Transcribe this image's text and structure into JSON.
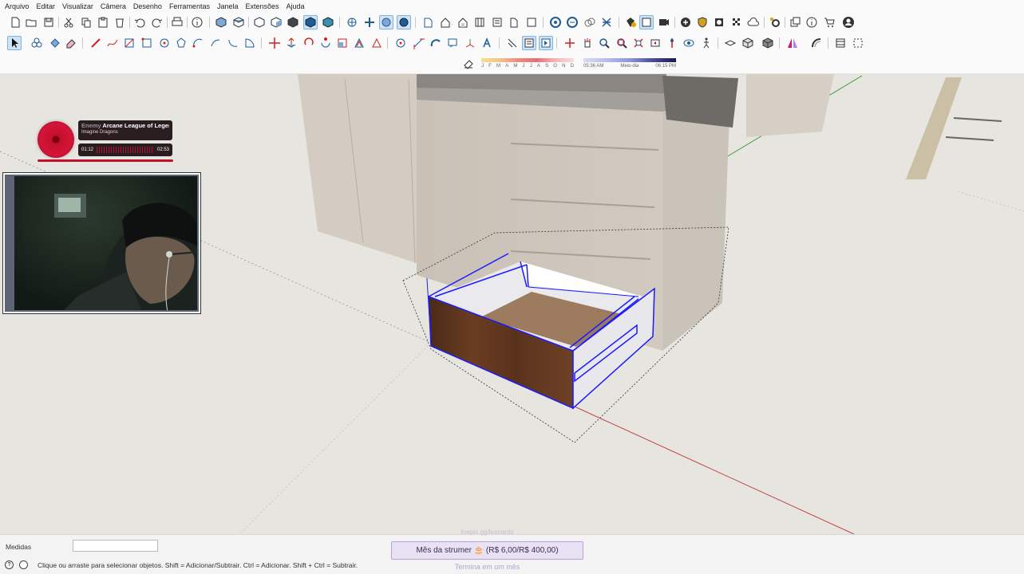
{
  "menu": {
    "items": [
      "Arquivo",
      "Editar",
      "Visualizar",
      "Câmera",
      "Desenho",
      "Ferramentas",
      "Janela",
      "Extensões",
      "Ajuda"
    ]
  },
  "shadow_settings": {
    "months": [
      "J",
      "F",
      "M",
      "A",
      "M",
      "J",
      "J",
      "A",
      "S",
      "O",
      "N",
      "D"
    ],
    "time_start": "05:36 AM",
    "time_mid": "Meio-dia",
    "time_end": "06:15 PM"
  },
  "music_widget": {
    "title": "Arcane League of Legends",
    "title_prefix": "Enemy",
    "artist": "Imagine Dragons",
    "elapsed": "01:12",
    "duration": "02:53",
    "accent": "#c3102a"
  },
  "status": {
    "measurements_label": "Medidas",
    "measurements_value": "",
    "hint": "Clique ou arraste para selecionar objetos. Shift = Adicionar/Subtrair. Ctrl = Adicionar. Shift + Ctrl = Subtrair."
  },
  "donation": {
    "top_text": "livepix.gg/leonardo",
    "label": "Mês da strumer 🎂 (R$ 6,00/R$ 400,00)",
    "sub": "Termina em um mês",
    "progress": 0.015
  },
  "colors": {
    "selection_blue": "#1a1aff",
    "axis_red": "#d02020",
    "axis_green": "#2aa02a",
    "viewport_bg": "#e6e5e0"
  }
}
